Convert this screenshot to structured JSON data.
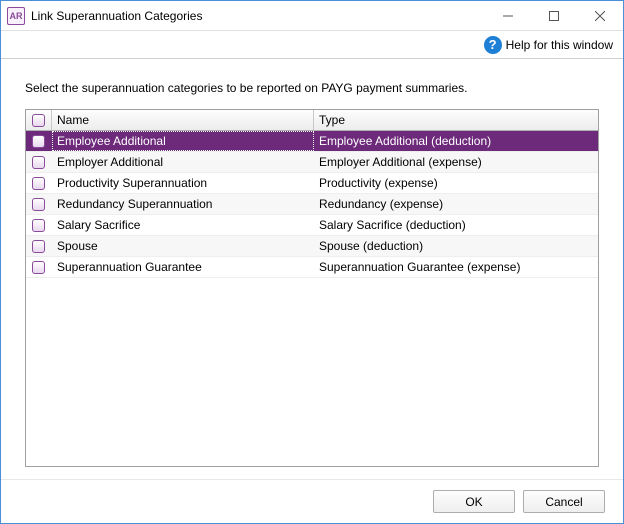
{
  "app_icon_text": "AR",
  "window_title": "Link Superannuation Categories",
  "help_label": "Help for this window",
  "instruction": "Select the superannuation categories to be reported on PAYG payment summaries.",
  "columns": {
    "name": "Name",
    "type": "Type"
  },
  "rows": [
    {
      "name": "Employee Additional",
      "type": "Employee Additional (deduction)",
      "selected": true
    },
    {
      "name": "Employer Additional",
      "type": "Employer Additional (expense)",
      "selected": false
    },
    {
      "name": "Productivity Superannuation",
      "type": "Productivity (expense)",
      "selected": false
    },
    {
      "name": "Redundancy Superannuation",
      "type": "Redundancy (expense)",
      "selected": false
    },
    {
      "name": "Salary Sacrifice",
      "type": "Salary Sacrifice (deduction)",
      "selected": false
    },
    {
      "name": "Spouse",
      "type": "Spouse (deduction)",
      "selected": false
    },
    {
      "name": "Superannuation Guarantee",
      "type": "Superannuation Guarantee (expense)",
      "selected": false
    }
  ],
  "buttons": {
    "ok": "OK",
    "cancel": "Cancel"
  }
}
